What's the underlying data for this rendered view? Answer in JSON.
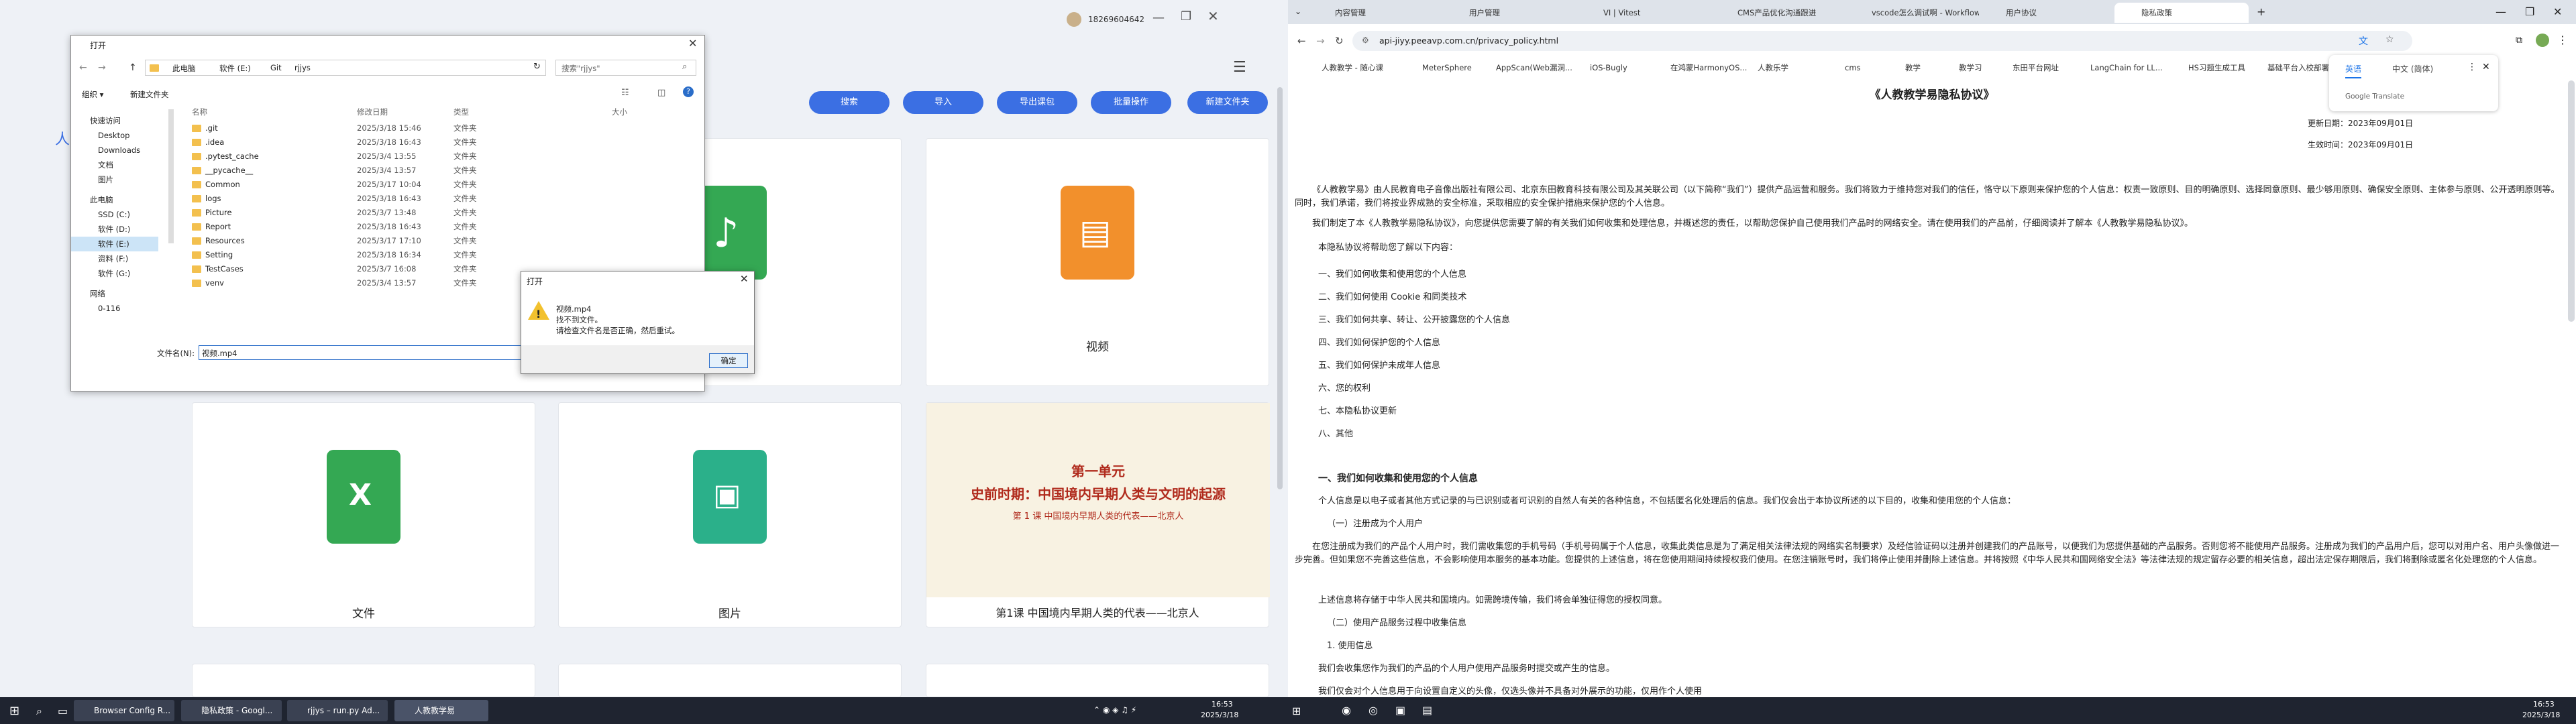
{
  "app": {
    "user_phone": "18269604642",
    "toolbar": [
      "搜索",
      "导入",
      "导出课包",
      "批量操作",
      "新建文件夹"
    ],
    "tiles": [
      "视频",
      "文件",
      "图片",
      "第1课 中国境内早期人类的代表——北京人"
    ],
    "lesson_card": {
      "line1": "第一单元",
      "line2": "史前时期：中国境内早期人类与文明的起源",
      "line3": "第 1 课   中国境内早期人类的代表——北京人"
    },
    "left_label": "人"
  },
  "file_dialog": {
    "title": "打开",
    "breadcrumb": [
      "此电脑",
      "软件 (E:)",
      "Git",
      "rjjys"
    ],
    "search_placeholder": "搜索\"rjjys\"",
    "organize": "组织 ▾",
    "new_folder": "新建文件夹",
    "columns": [
      "名称",
      "修改日期",
      "类型",
      "大小"
    ],
    "files": [
      {
        "name": ".git",
        "date": "2025/3/18 15:46",
        "type": "文件夹"
      },
      {
        "name": ".idea",
        "date": "2025/3/18 16:43",
        "type": "文件夹"
      },
      {
        "name": ".pytest_cache",
        "date": "2025/3/4 13:55",
        "type": "文件夹"
      },
      {
        "name": "__pycache__",
        "date": "2025/3/4 13:57",
        "type": "文件夹"
      },
      {
        "name": "Common",
        "date": "2025/3/17 10:04",
        "type": "文件夹"
      },
      {
        "name": "logs",
        "date": "2025/3/18 16:43",
        "type": "文件夹"
      },
      {
        "name": "Picture",
        "date": "2025/3/7 13:48",
        "type": "文件夹"
      },
      {
        "name": "Report",
        "date": "2025/3/18 16:43",
        "type": "文件夹"
      },
      {
        "name": "Resources",
        "date": "2025/3/17 17:10",
        "type": "文件夹"
      },
      {
        "name": "Setting",
        "date": "2025/3/18 16:34",
        "type": "文件夹"
      },
      {
        "name": "TestCases",
        "date": "2025/3/7 16:08",
        "type": "文件夹"
      },
      {
        "name": "venv",
        "date": "2025/3/4 13:57",
        "type": "文件夹"
      }
    ],
    "nav": [
      "快速访问",
      "Desktop",
      "Downloads",
      "文档",
      "图片",
      "此电脑",
      "SSD (C:)",
      "软件 (D:)",
      "软件 (E:)",
      "资料 (F:)",
      "软件 (G:)",
      "网络",
      "0-116"
    ],
    "filename_label": "文件名(N):",
    "filename_value": "视频.mp4"
  },
  "message_box": {
    "title": "打开",
    "line1": "视频.mp4",
    "line2": "找不到文件。",
    "line3": "请检查文件名是否正确，然后重试。",
    "ok": "确定"
  },
  "browser": {
    "tabs": [
      "内容管理",
      "用户管理",
      "VI | Vitest",
      "CMS产品优化沟通跟进",
      "vscode怎么调试啊 - Workflow",
      "用户协议",
      "隐私政策"
    ],
    "url": "api-jiyy.peeavp.com.cn/privacy_policy.html",
    "bookmarks": [
      "人教教学 - 随心课",
      "MeterSphere",
      "AppScan(Web漏洞...",
      "iOS-Bugly",
      "在鸿蒙HarmonyOS...",
      "人教乐学",
      "cms",
      "教学",
      "教学习",
      "东田平台网址",
      "LangChain for LL...",
      "HS习题生成工具",
      "基础平台入校部署..."
    ],
    "translate": {
      "lang1": "英语",
      "lang2": "中文 (简体)",
      "footer": "Google Translate"
    },
    "doc": {
      "title": "《人教教学易隐私协议》",
      "updated": "更新日期：2023年09月01日",
      "effective": "生效时间：2023年09月01日",
      "para1": "《人教教学易》由人民教育电子音像出版社有限公司、北京东田教育科技有限公司及其关联公司（以下简称“我们”）提供产品运营和服务。我们将致力于维持您对我们的信任，恪守以下原则来保护您的个人信息：权责一致原则、目的明确原则、选择同意原则、最少够用原则、确保安全原则、主体参与原则、公开透明原则等。同时，我们承诺，我们将按业界成熟的安全标准，采取相应的安全保护措施来保护您的个人信息。",
      "para2": "我们制定了本《人教教学易隐私协议》，向您提供您需要了解的有关我们如何收集和处理信息，并概述您的责任，以帮助您保护自己使用我们产品时的网络安全。请在使用我们的产品前，仔细阅读并了解本《人教教学易隐私协议》。",
      "intro": "本隐私协议将帮助您了解以下内容：",
      "toc": [
        "一、我们如何收集和使用您的个人信息",
        "二、我们如何使用 Cookie 和同类技术",
        "三、我们如何共享、转让、公开披露您的个人信息",
        "四、我们如何保护您的个人信息",
        "五、我们如何保护未成年人信息",
        "六、您的权利",
        "七、本隐私协议更新",
        "八、其他"
      ],
      "h1": "一、我们如何收集和使用您的个人信息",
      "p3": "个人信息是以电子或者其他方式记录的与已识别或者可识别的自然人有关的各种信息，不包括匿名化处理后的信息。我们仅会出于本协议所述的以下目的，收集和使用您的个人信息：",
      "p4": "（一）注册成为个人用户",
      "p5": "在您注册成为我们的产品个人用户时，我们需收集您的手机号码（手机号码属于个人信息，收集此类信息是为了满足相关法律法规的网络实名制要求）及经信验证码以注册并创建我们的产品账号，以便我们为您提供基础的产品服务。否则您将不能使用产品服务。注册成为我们的产品用户后，您可以对用户名、用户头像做进一步完善。但如果您不完善这些信息，不会影响使用本服务的基本功能。您提供的上述信息，将在您使用期间持续授权我们使用。在您注销账号时，我们将停止使用并删除上述信息。并将按照《中华人民共和国网络安全法》等法律法规的规定留存必要的相关信息，超出法定保存期限后，我们将删除或匿名化处理您的个人信息。",
      "p6": "上述信息将存储于中华人民共和国境内。如需跨境传输，我们将会单独征得您的授权同意。",
      "p7": "（二）使用产品服务过程中收集信息",
      "p8": "1. 使用信息",
      "p9": "我们会收集您作为我们的产品的个人用户使用产品服务时提交或产生的信息。",
      "p10": "我们仅会对个人信息用于向设置自定义的头像，仅选头像并不具备对外展示的功能，仅用作个人使用"
    }
  },
  "taskbar": {
    "items": [
      "Browser Config R...",
      "隐私政策 - Googl...",
      "rjjys – run.py Ad...",
      "人教教学易"
    ],
    "time_left": "16:53",
    "date_left": "2025/3/18",
    "time_right": "16:53",
    "date_right": "2025/3/18"
  },
  "colors": {
    "accent": "#3b6fe3",
    "green": "#34a853",
    "orange": "#f2902c",
    "taskbar": "#1f2430"
  }
}
